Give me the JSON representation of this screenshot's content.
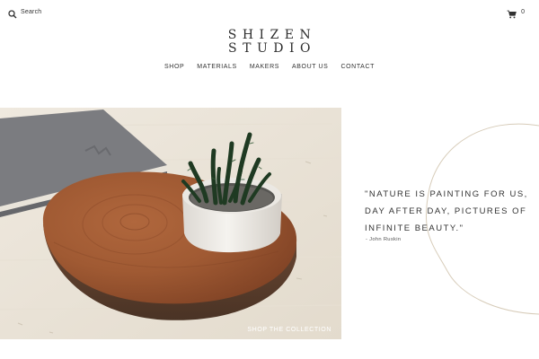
{
  "header": {
    "search_label": "Search",
    "search_icon": "search-icon",
    "cart_icon": "cart-icon",
    "cart_count": "0"
  },
  "logo": {
    "line1": "SHIZEN",
    "line2": "STUDIO"
  },
  "nav": {
    "items": [
      "SHOP",
      "MATERIALS",
      "MAKERS",
      "ABOUT US",
      "CONTACT"
    ]
  },
  "hero": {
    "cta_label": "SHOP THE COLLECTION"
  },
  "quote": {
    "text": "\"NATURE IS PAINTING FOR US, DAY AFTER DAY, PICTURES OF INFINITE BEAUTY.\"",
    "author": "- John Ruskin"
  },
  "colors": {
    "text": "#333333",
    "background": "#ffffff",
    "arc_line": "#d7ccb9",
    "cta_text": "#ffffff"
  }
}
